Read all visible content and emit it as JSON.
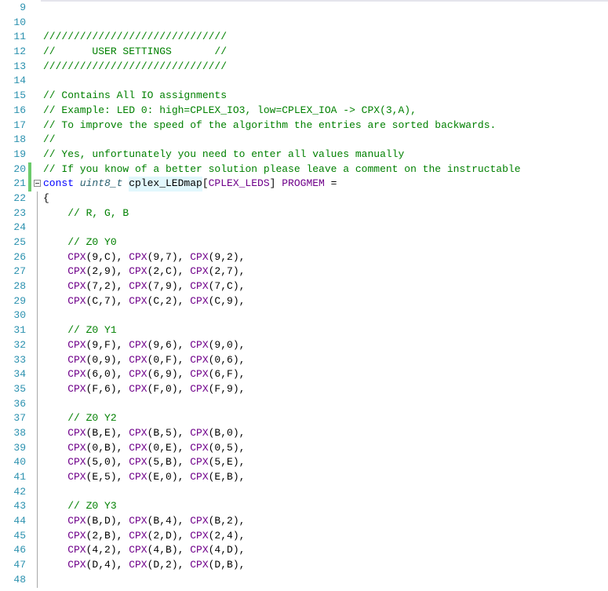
{
  "lines": [
    {
      "n": "9",
      "text": ""
    },
    {
      "n": "10",
      "text": ""
    },
    {
      "n": "11",
      "text": "//////////////////////////////"
    },
    {
      "n": "12",
      "text": "//      USER SETTINGS       //"
    },
    {
      "n": "13",
      "text": "//////////////////////////////"
    },
    {
      "n": "14",
      "text": ""
    },
    {
      "n": "15",
      "text": "// Contains All IO assignments"
    },
    {
      "n": "16",
      "text": "// Example: LED 0: high=CPLEX_IO3, low=CPLEX_IOA -> CPX(3,A),"
    },
    {
      "n": "17",
      "text": "// To improve the speed of the algorithm the entries are sorted backwards."
    },
    {
      "n": "18",
      "text": "//"
    },
    {
      "n": "19",
      "text": "// Yes, unfortunately you need to enter all values manually"
    },
    {
      "n": "20",
      "text": "// If you know of a better solution please leave a comment on the instructable",
      "changed": true
    },
    {
      "n": "21",
      "text": "const uint8_t cplex_LEDmap[CPLEX_LEDS] PROGMEM =",
      "changed": true,
      "fold": true
    },
    {
      "n": "22",
      "text": "{"
    },
    {
      "n": "23",
      "text": "    // R, G, B"
    },
    {
      "n": "24",
      "text": ""
    },
    {
      "n": "25",
      "text": "    // Z0 Y0"
    },
    {
      "n": "26",
      "text": "    CPX(9,C), CPX(9,7), CPX(9,2),"
    },
    {
      "n": "27",
      "text": "    CPX(2,9), CPX(2,C), CPX(2,7),"
    },
    {
      "n": "28",
      "text": "    CPX(7,2), CPX(7,9), CPX(7,C),"
    },
    {
      "n": "29",
      "text": "    CPX(C,7), CPX(C,2), CPX(C,9),"
    },
    {
      "n": "30",
      "text": ""
    },
    {
      "n": "31",
      "text": "    // Z0 Y1"
    },
    {
      "n": "32",
      "text": "    CPX(9,F), CPX(9,6), CPX(9,0),"
    },
    {
      "n": "33",
      "text": "    CPX(0,9), CPX(0,F), CPX(0,6),"
    },
    {
      "n": "34",
      "text": "    CPX(6,0), CPX(6,9), CPX(6,F),"
    },
    {
      "n": "35",
      "text": "    CPX(F,6), CPX(F,0), CPX(F,9),"
    },
    {
      "n": "36",
      "text": ""
    },
    {
      "n": "37",
      "text": "    // Z0 Y2"
    },
    {
      "n": "38",
      "text": "    CPX(B,E), CPX(B,5), CPX(B,0),"
    },
    {
      "n": "39",
      "text": "    CPX(0,B), CPX(0,E), CPX(0,5),"
    },
    {
      "n": "40",
      "text": "    CPX(5,0), CPX(5,B), CPX(5,E),"
    },
    {
      "n": "41",
      "text": "    CPX(E,5), CPX(E,0), CPX(E,B),"
    },
    {
      "n": "42",
      "text": ""
    },
    {
      "n": "43",
      "text": "    // Z0 Y3"
    },
    {
      "n": "44",
      "text": "    CPX(B,D), CPX(B,4), CPX(B,2),"
    },
    {
      "n": "45",
      "text": "    CPX(2,B), CPX(2,D), CPX(2,4),"
    },
    {
      "n": "46",
      "text": "    CPX(4,2), CPX(4,B), CPX(4,D),"
    },
    {
      "n": "47",
      "text": "    CPX(D,4), CPX(D,2), CPX(D,B),"
    },
    {
      "n": "48",
      "text": ""
    }
  ]
}
